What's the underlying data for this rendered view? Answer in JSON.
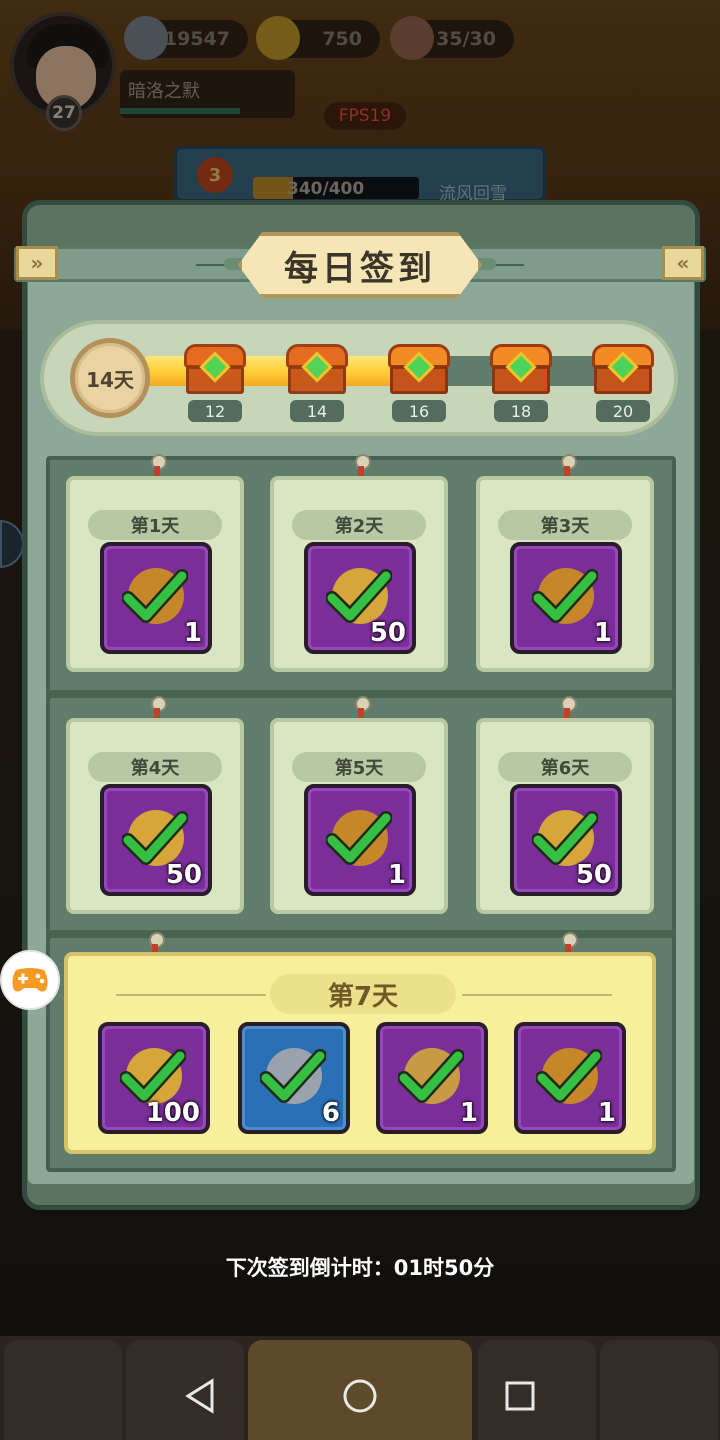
{
  "top_hud": {
    "coins": "19547",
    "gold": "750",
    "stamina": "35/30",
    "player_name": "暗洛之默",
    "player_level": "27",
    "fps": "FPS19"
  },
  "stage_bar": {
    "stage_num": "3",
    "progress": "340/400",
    "stage_name": "流风回雪"
  },
  "dialog": {
    "title": "每日签到",
    "current_days": "14天",
    "progress_fraction": 0.56,
    "milestones": [
      {
        "days": "12",
        "status": "claimed"
      },
      {
        "days": "14",
        "status": "claimed"
      },
      {
        "days": "16",
        "status": "locked"
      },
      {
        "days": "18",
        "status": "locked"
      },
      {
        "days": "20",
        "status": "locked"
      }
    ],
    "days": [
      {
        "label": "第1天",
        "qty": "1",
        "icon": "gold-pot-icon"
      },
      {
        "label": "第2天",
        "qty": "50",
        "icon": "heart-icon"
      },
      {
        "label": "第3天",
        "qty": "1",
        "icon": "gold-pot-icon"
      },
      {
        "label": "第4天",
        "qty": "50",
        "icon": "heart-icon"
      },
      {
        "label": "第5天",
        "qty": "1",
        "icon": "gold-pot-icon"
      },
      {
        "label": "第6天",
        "qty": "50",
        "icon": "heart-icon"
      }
    ],
    "day7": {
      "label": "第7天",
      "items": [
        {
          "qty": "100",
          "icon": "heart-icon",
          "style": "purple"
        },
        {
          "qty": "6",
          "icon": "feather-arrow-icon",
          "style": "blue"
        },
        {
          "qty": "1",
          "icon": "scroll-icon",
          "style": "purple"
        },
        {
          "qty": "1",
          "icon": "gold-pot-icon",
          "style": "purple"
        }
      ]
    },
    "countdown": "下次签到倒计时：01时50分"
  },
  "colors": {
    "panel": "#5b7462",
    "card": "#d9e6c4",
    "item_purple": "#7a2e9a",
    "check_green": "#2fb53a",
    "day7_bg": "#f7ef9c"
  }
}
